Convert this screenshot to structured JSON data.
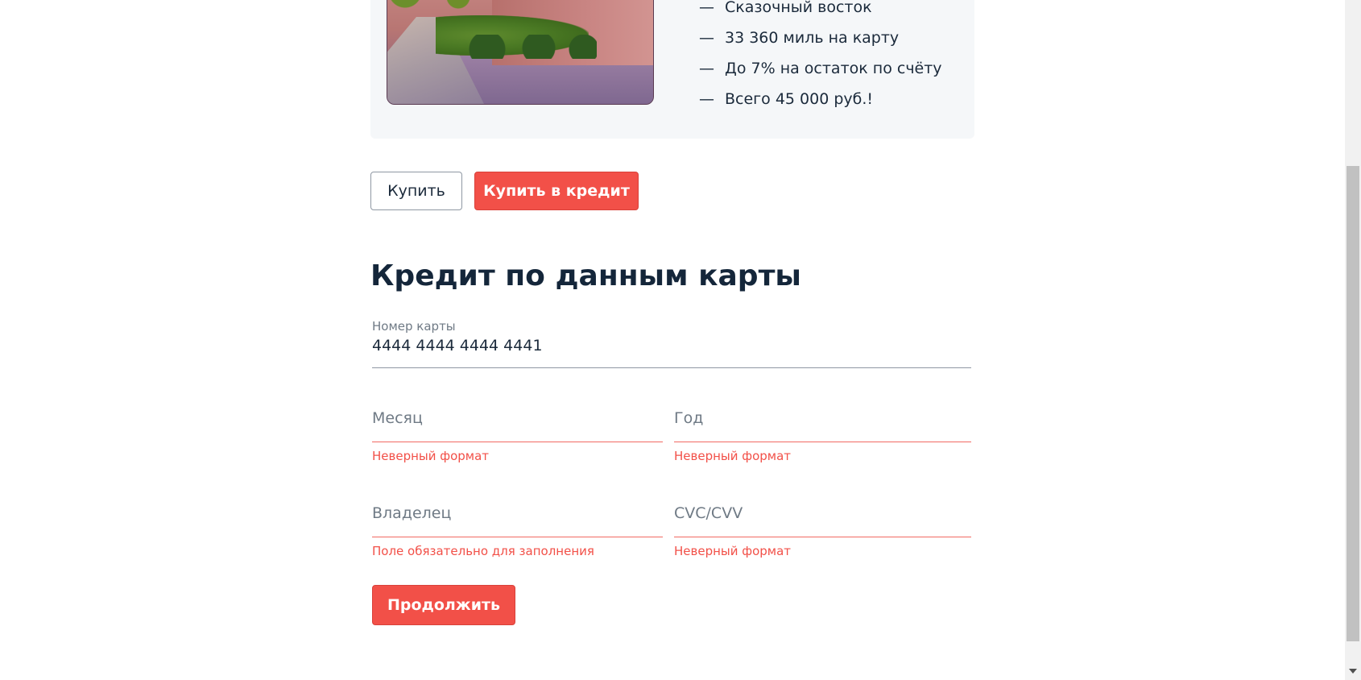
{
  "tour": {
    "features": [
      "Сказочный восток",
      "33 360 миль на карту",
      "До 7% на остаток по счёту",
      "Всего 45 000 руб.!"
    ],
    "dash": "—"
  },
  "actions": {
    "buy_label": "Купить",
    "buy_credit_label": "Купить в кредит"
  },
  "credit_form": {
    "title": "Кредит по данным карты",
    "card_number": {
      "label": "Номер карты",
      "value": "4444 4444 4444 4441"
    },
    "month": {
      "placeholder": "Месяц",
      "error": "Неверный формат"
    },
    "year": {
      "placeholder": "Год",
      "error": "Неверный формат"
    },
    "owner": {
      "placeholder": "Владелец",
      "error": "Поле обязательно для заполнения"
    },
    "cvc": {
      "placeholder": "CVC/CVV",
      "error": "Неверный формат"
    },
    "submit_label": "Продолжить"
  },
  "colors": {
    "accent": "#f25048",
    "error": "#f25048",
    "text": "#1b2a3b",
    "muted": "#6f7a85",
    "card_bg": "#f5f7f9"
  }
}
